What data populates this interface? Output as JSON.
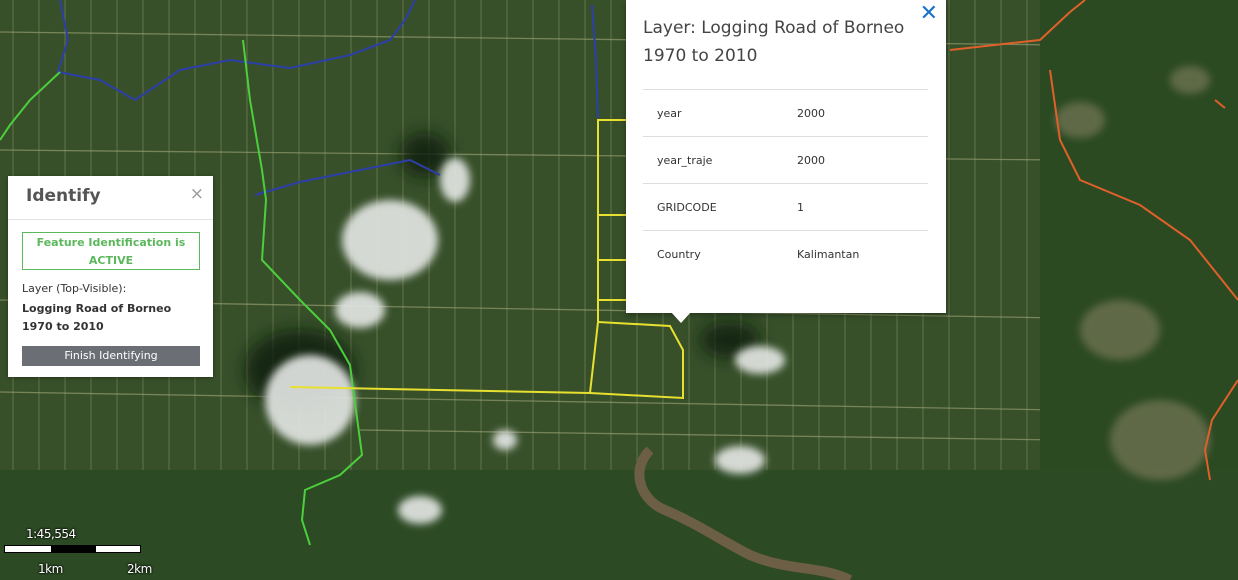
{
  "identify_panel": {
    "title": "Identify",
    "close_glyph": "×",
    "status": "Feature Identification is ACTIVE",
    "layer_label": "Layer (Top-Visible):",
    "layer_name": "Logging Road of Borneo 1970 to 2010",
    "finish_button": "Finish Identifying",
    "status_color": "#5cb85c"
  },
  "popup": {
    "title": "Layer: Logging Road of Borneo 1970 to 2010",
    "close_glyph": "✕",
    "close_color": "#1a73c9",
    "attributes": [
      {
        "key": "year",
        "value": "2000"
      },
      {
        "key": "year_traje",
        "value": "2000"
      },
      {
        "key": "GRIDCODE",
        "value": "1"
      },
      {
        "key": "Country",
        "value": "Kalimantan"
      }
    ]
  },
  "scale": {
    "ratio": "1:45,554",
    "label_1": "1km",
    "label_2": "2km"
  },
  "map_layers": {
    "logging_road_color": "#e8e030",
    "boundary_green_color": "#4ccf3c",
    "river_blue_color": "#2d3fa8",
    "road_orange_color": "#e0602a"
  }
}
